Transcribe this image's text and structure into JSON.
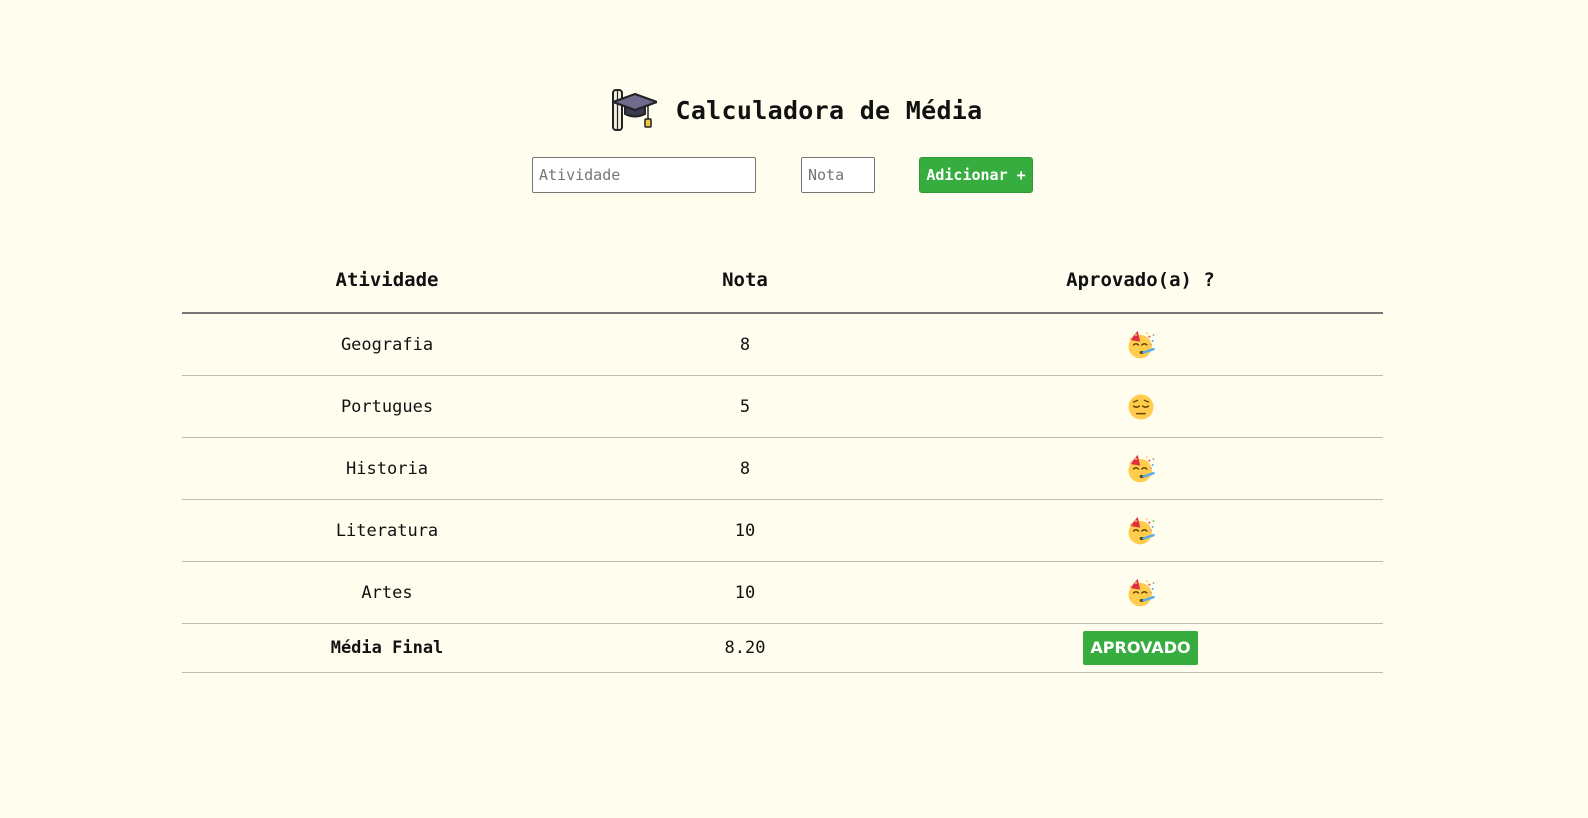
{
  "header": {
    "title": "Calculadora de Média",
    "logo_icon": "graduation-cap-icon"
  },
  "form": {
    "activity_placeholder": "Atividade",
    "grade_placeholder": "Nota",
    "add_label": "Adicionar +"
  },
  "table": {
    "headers": [
      "Atividade",
      "Nota",
      "Aprovado(a) ?"
    ],
    "rows": [
      {
        "activity": "Geografia",
        "grade": "8",
        "status_icon": "party-face-icon"
      },
      {
        "activity": "Portugues",
        "grade": "5",
        "status_icon": "pensive-face-icon"
      },
      {
        "activity": "Historia",
        "grade": "8",
        "status_icon": "party-face-icon"
      },
      {
        "activity": "Literatura",
        "grade": "10",
        "status_icon": "party-face-icon"
      },
      {
        "activity": "Artes",
        "grade": "10",
        "status_icon": "party-face-icon"
      }
    ],
    "footer": {
      "label": "Média Final",
      "value": "8.20",
      "status": "APROVADO"
    }
  },
  "colors": {
    "background": "#fffdee",
    "accent_green": "#37ad3f"
  }
}
